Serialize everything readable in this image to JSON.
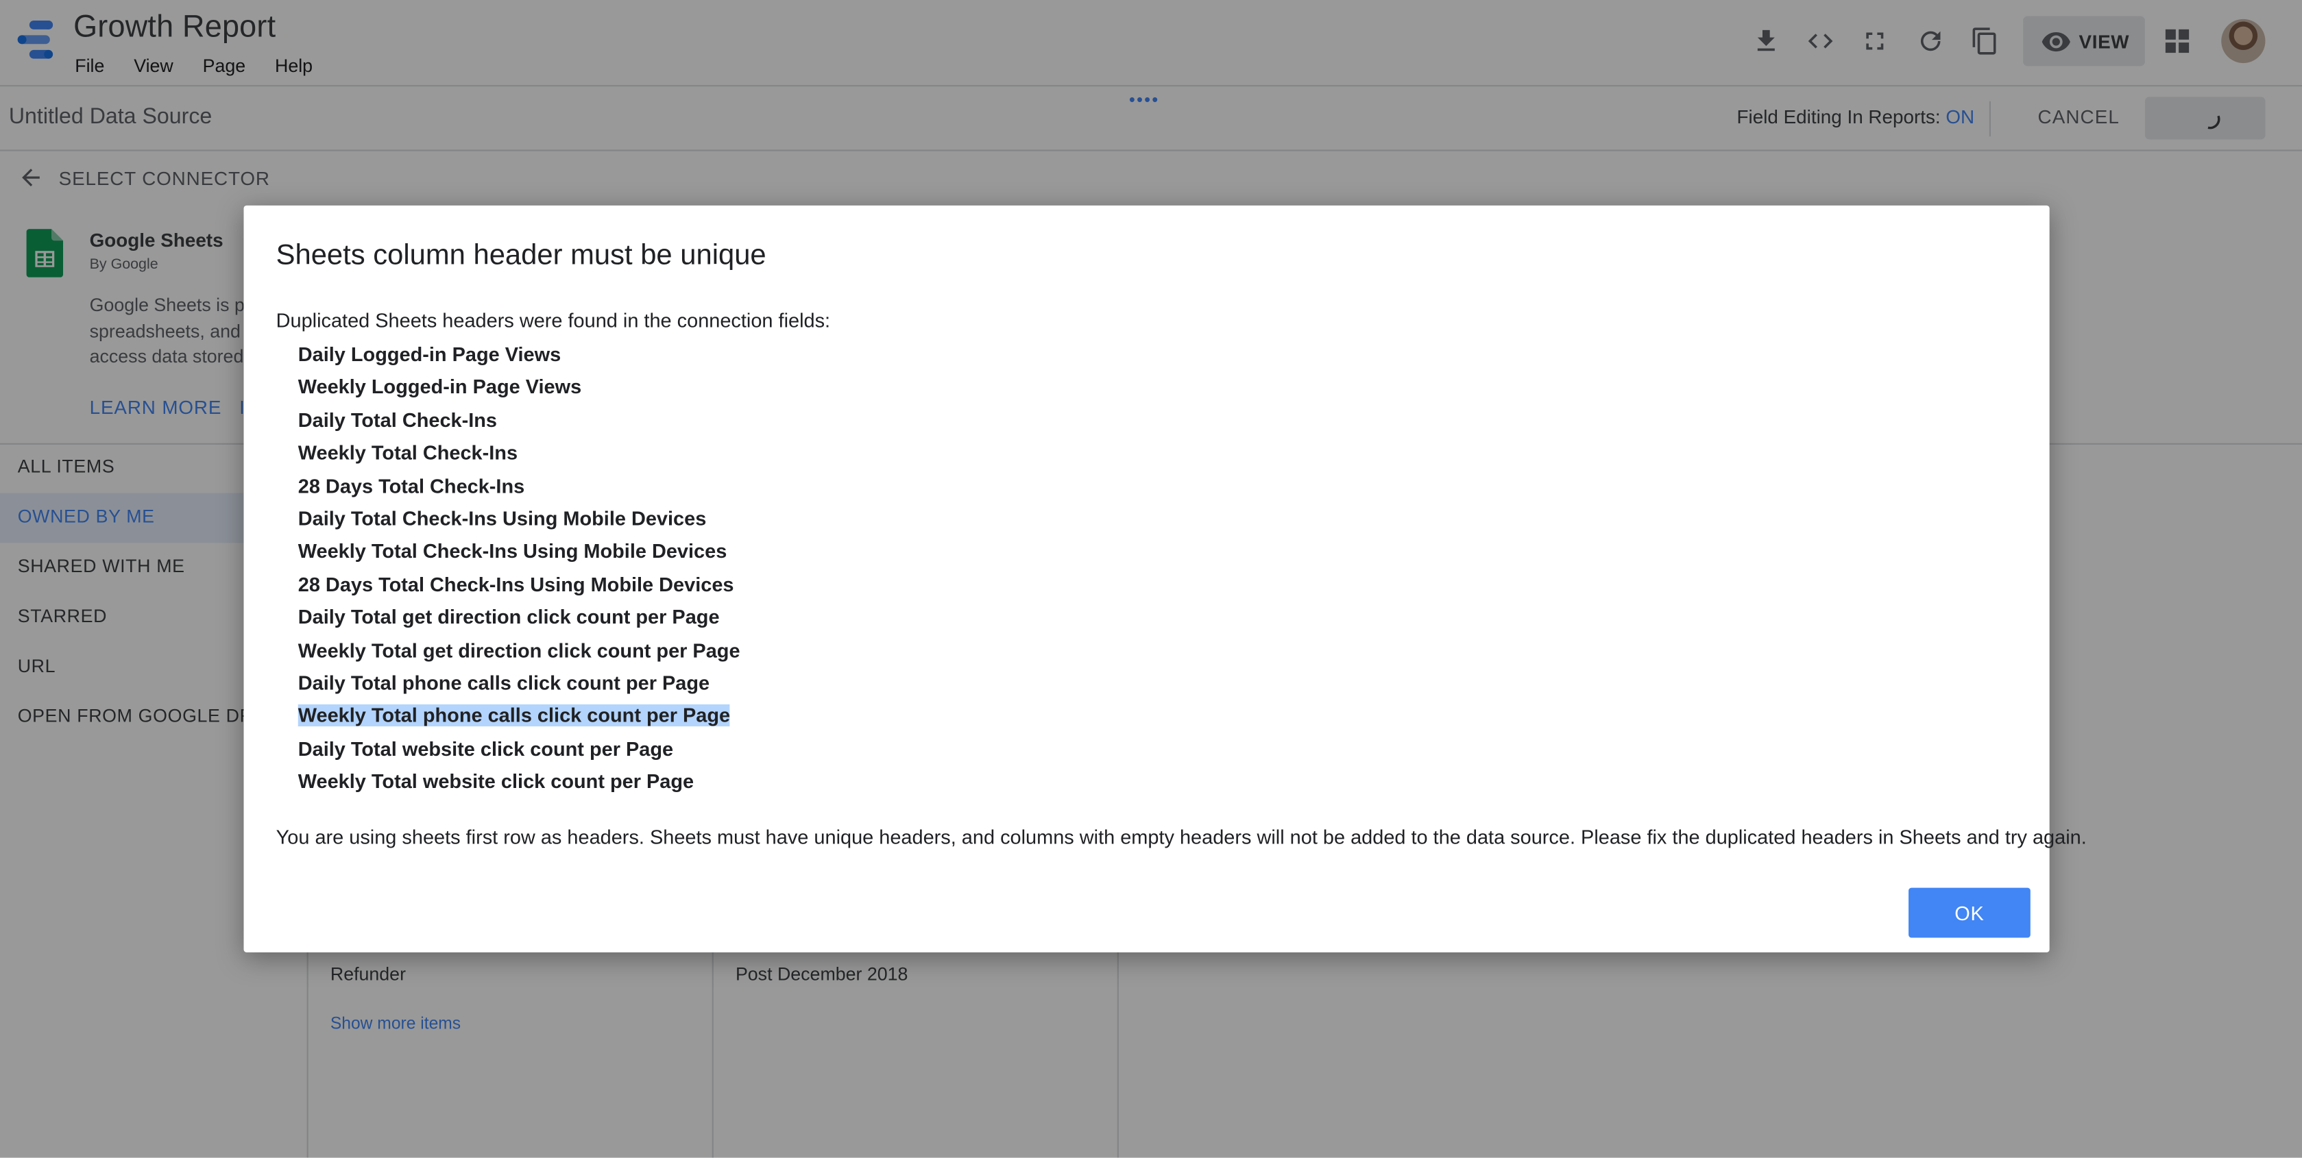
{
  "app": {
    "title": "Growth Report",
    "menu": [
      "File",
      "View",
      "Page",
      "Help"
    ],
    "view_button_label": "VIEW",
    "toolbar_icons": [
      "download-icon",
      "embed-code-icon",
      "fullscreen-icon",
      "refresh-icon",
      "copy-icon",
      "eye-icon",
      "apps-grid-icon"
    ]
  },
  "datasource_bar": {
    "name": "Untitled Data Source",
    "field_editing_label": "Field Editing In Reports:",
    "field_editing_value": "ON",
    "cancel_label": "CANCEL"
  },
  "connector": {
    "back_label": "SELECT CONNECTOR",
    "name": "Google Sheets",
    "by": "By Google",
    "desc_lines": [
      "Google Sheets is pa",
      "spreadsheets, and w",
      "access data stored"
    ],
    "learn_more": "LEARN MORE",
    "second_link": "I"
  },
  "nav": {
    "items": [
      "ALL ITEMS",
      "OWNED BY ME",
      "SHARED WITH ME",
      "STARRED",
      "URL",
      "OPEN FROM GOOGLE DRIVE"
    ],
    "active_index": 1
  },
  "lists": {
    "col1_item": "Refunder",
    "col2_item": "Post December 2018",
    "show_more": "Show more items"
  },
  "dialog": {
    "title": "Sheets column header must be unique",
    "intro": "Duplicated Sheets headers were found in the connection fields:",
    "duplicates": [
      "Daily Logged-in Page Views",
      "Weekly Logged-in Page Views",
      "Daily Total Check-Ins",
      "Weekly Total Check-Ins",
      "28 Days Total Check-Ins",
      "Daily Total Check-Ins Using Mobile Devices",
      "Weekly Total Check-Ins Using Mobile Devices",
      "28 Days Total Check-Ins Using Mobile Devices",
      "Daily Total get direction click count per Page",
      "Weekly Total get direction click count per Page",
      "Daily Total phone calls click count per Page",
      "Weekly Total phone calls click count per Page",
      "Daily Total website click count per Page",
      "Weekly Total website click count per Page"
    ],
    "selected_index": 11,
    "note": "You are using sheets first row as headers. Sheets must have unique headers, and columns with empty headers will not be added to the data source. Please fix the duplicated headers in Sheets and try again.",
    "ok_label": "OK"
  },
  "colors": {
    "accent": "#4285f4",
    "selection": "#b3d4fc",
    "sheets_green": "#0f9d58"
  }
}
